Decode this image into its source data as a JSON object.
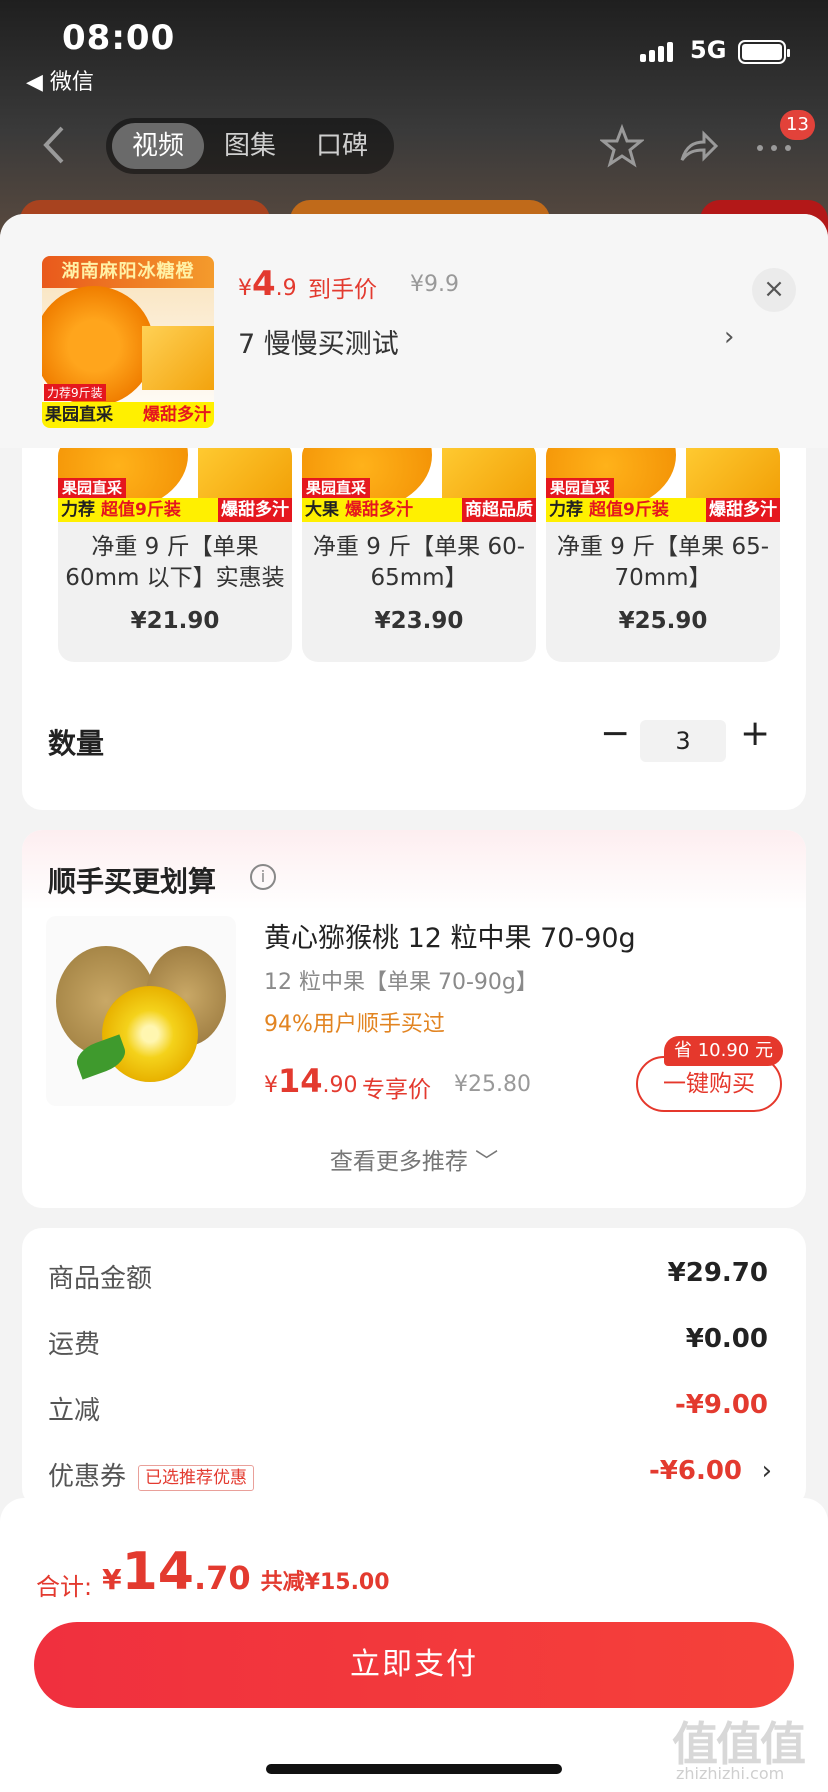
{
  "status_bar": {
    "time": "08:00",
    "back_app": "◀ 微信",
    "network": "5G"
  },
  "nav": {
    "tabs": [
      "视频",
      "图集",
      "口碑"
    ],
    "active_tab": 0,
    "badge": "13"
  },
  "product_preview": {
    "thumb_title": "湖南麻阳冰糖橙",
    "thumb_tag": "力荐9斤装",
    "thumb_bottom_left": "果园直采",
    "thumb_bottom_right": "爆甜多汁",
    "price_symbol": "¥",
    "price_int": "4",
    "price_dec": ".9",
    "price_label": "到手价",
    "orig_price": "¥9.9",
    "sku_text": "7  慢慢买测试",
    "arrow": "›",
    "close": "×"
  },
  "sku_options": [
    {
      "label_top": "果园直采",
      "label_mid": [
        "力荐",
        "超值9斤装"
      ],
      "label_right": "爆甜多汁",
      "name": "净重 9 斤【单果 60mm 以下】实惠装",
      "price": "¥21.90"
    },
    {
      "label_top": "果园直采",
      "label_mid": [
        "大果",
        "爆甜多汁"
      ],
      "label_right": "商超品质",
      "name": "净重 9 斤【单果 60-65mm】",
      "price": "¥23.90"
    },
    {
      "label_top": "果园直采",
      "label_mid": [
        "力荐",
        "超值9斤装"
      ],
      "label_right": "爆甜多汁",
      "name": "净重 9 斤【单果 65-70mm】",
      "price": "¥25.90"
    }
  ],
  "quantity": {
    "label": "数量",
    "minus": "−",
    "value": "3",
    "plus": "+"
  },
  "recommend": {
    "title": "顺手买更划算",
    "info": "i",
    "name": "黄心猕猴桃 12 粒中果 70-90g",
    "spec": "12 粒中果【单果 70-90g】",
    "buyers": "94%用户顺手买过",
    "price_symbol": "¥",
    "price_int": "14",
    "price_dec": ".90",
    "price_label": "专享价",
    "orig_price": "¥25.80",
    "save_tag": "省 10.90 元",
    "buy_button": "一键购买",
    "more": "查看更多推荐 ﹀"
  },
  "summary": {
    "rows": [
      {
        "label": "商品金额",
        "value": "¥29.70"
      },
      {
        "label": "运费",
        "value": "¥0.00"
      },
      {
        "label": "立减",
        "value": "-¥9.00"
      },
      {
        "label": "优惠券",
        "value": "-¥6.00"
      }
    ],
    "coupon_tag": "已选推荐优惠",
    "arrow": "›"
  },
  "footer": {
    "total_label": "合计:",
    "total_yen": "¥",
    "total_int": "14",
    "total_dec": ".70",
    "total_saved": "共减¥15.00",
    "pay_button": "立即支付"
  },
  "watermark": {
    "main": "值值值",
    "sub": "zhizhizhi.com"
  },
  "colors": {
    "accent": "#e33a2f",
    "pay_gradient_start": "#f0303e",
    "orange_text": "#e28421"
  }
}
